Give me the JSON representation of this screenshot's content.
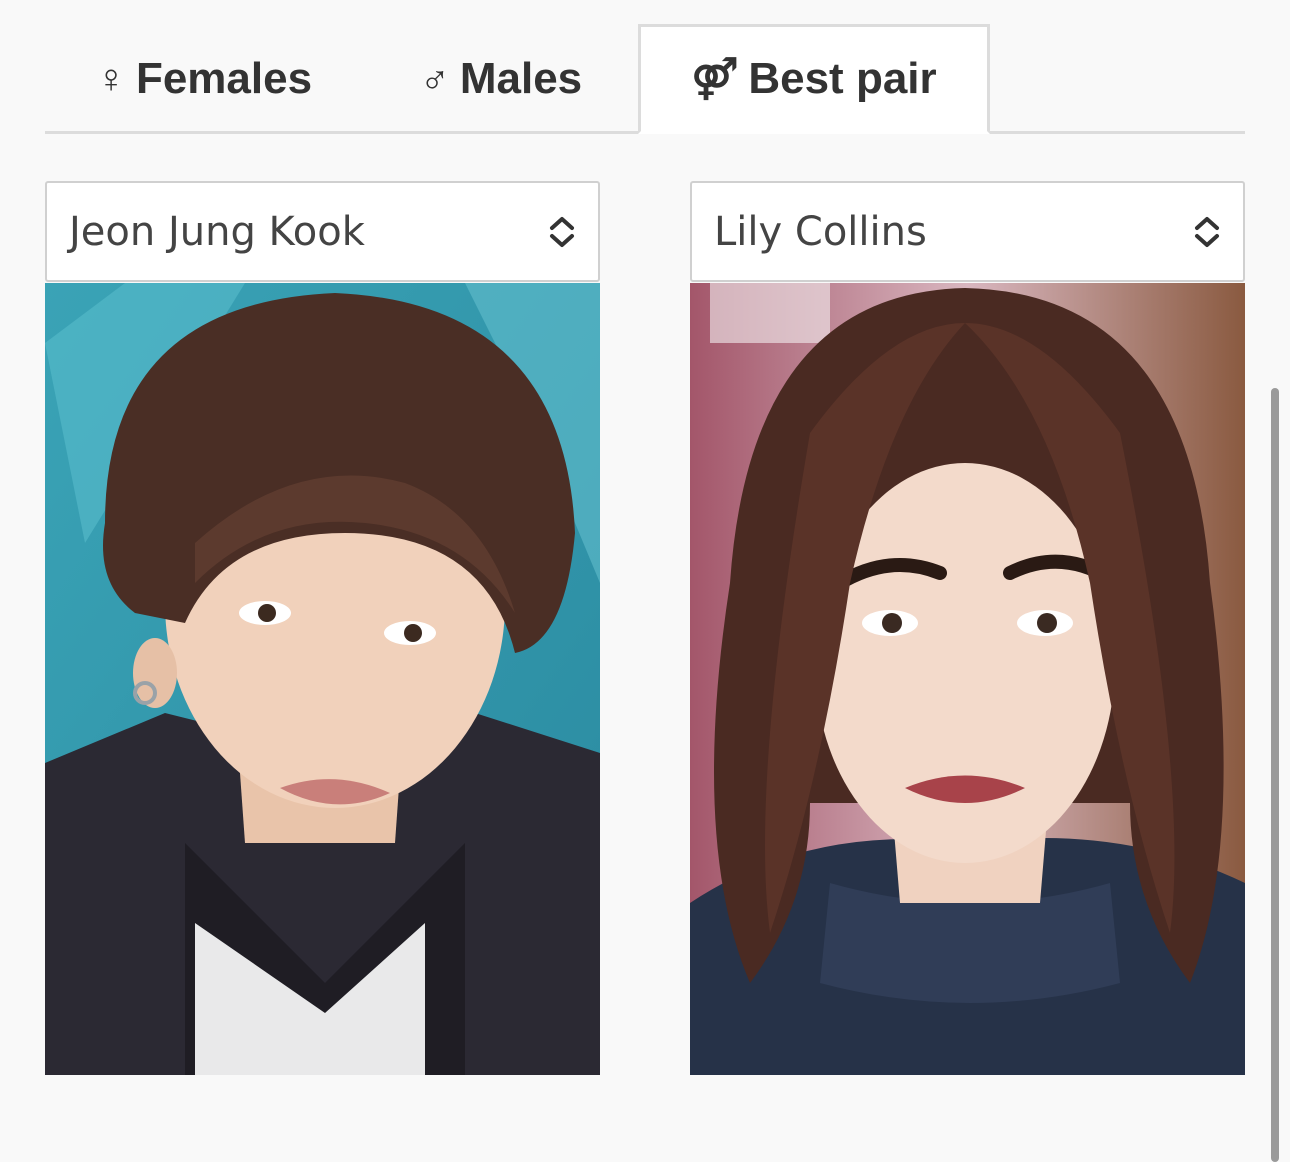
{
  "tabs": [
    {
      "icon": "female-icon",
      "symbol": "♀",
      "label": "Females",
      "active": false
    },
    {
      "icon": "male-icon",
      "symbol": "♂",
      "label": "Males",
      "active": false
    },
    {
      "icon": "pair-icon",
      "symbol": "⚤",
      "label": "Best pair",
      "active": true
    }
  ],
  "selects": {
    "left": {
      "value": "Jeon Jung Kook"
    },
    "right": {
      "value": "Lily Collins"
    }
  },
  "colors": {
    "tab_border": "#dcdcdc",
    "background": "#f9f9f9",
    "text": "#333333"
  }
}
